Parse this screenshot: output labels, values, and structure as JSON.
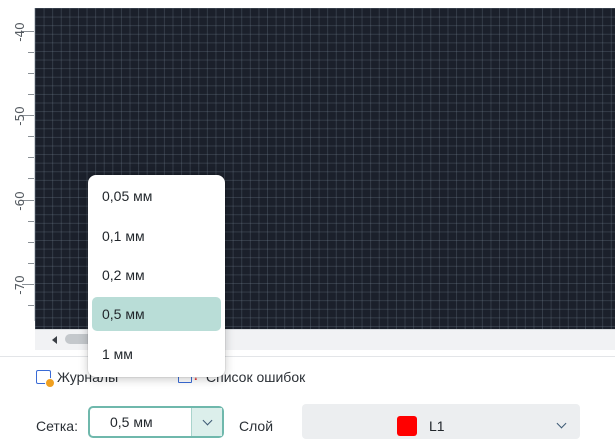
{
  "ruler": {
    "labels": [
      "-40",
      "-50",
      "-60",
      "-70"
    ]
  },
  "grid_dropdown": {
    "options": [
      "0,05 мм",
      "0,1 мм",
      "0,2 мм",
      "0,5 мм",
      "1 мм"
    ],
    "selected": "0,5 мм"
  },
  "tabs": {
    "logs": "Журналы",
    "errors": "Список ошибок"
  },
  "settings": {
    "grid_label": "Сетка:",
    "grid_value": "0,5 мм",
    "layer_label": "Слой",
    "layer_value": "L1",
    "layer_color": "#ff0000"
  },
  "colors": {
    "canvas_bg": "#1b202b",
    "accent": "#6fb8ac",
    "selected_option_bg": "#b9ddd7"
  }
}
